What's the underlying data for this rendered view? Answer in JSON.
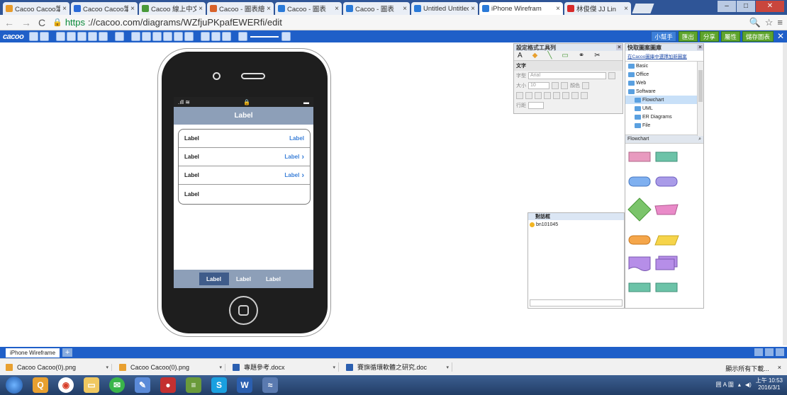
{
  "browser": {
    "tabs": [
      {
        "title": "Cacoo Cacoo筆記",
        "color": "#e89b2a"
      },
      {
        "title": "Cacoo Cacoo筆記",
        "color": "#2a6ad8"
      },
      {
        "title": "Cacoo 線上中文",
        "color": "#4a9a3a"
      },
      {
        "title": "Cacoo - 圖表繪製",
        "color": "#d8622a"
      },
      {
        "title": "Cacoo - 圖表",
        "color": "#2a7ad8"
      },
      {
        "title": "Cacoo - 圖表",
        "color": "#2a7ad8"
      },
      {
        "title": "Untitled Untitled",
        "color": "#2a7ad8"
      },
      {
        "title": "iPhone Wirefram",
        "color": "#2a7ad8",
        "active": true
      },
      {
        "title": "林俊傑 JJ Lin",
        "color": "#d82a2a"
      }
    ],
    "url_scheme": "https",
    "url_rest": "://cacoo.com/diagrams/WZfjuPKpafEWERfi/edit"
  },
  "app": {
    "logo": "cacoo",
    "right_buttons": [
      "小幫手",
      "匯出",
      "分享",
      "屬性",
      "儲存圖表"
    ]
  },
  "phone": {
    "navbar_title": "Label",
    "rows": [
      {
        "label": "Label",
        "value": "Label",
        "chevron": false
      },
      {
        "label": "Label",
        "value": "Label",
        "chevron": true
      },
      {
        "label": "Label",
        "value": "Label",
        "chevron": true
      },
      {
        "label": "Label",
        "value": "",
        "chevron": false
      }
    ],
    "tabs": [
      "Label",
      "Label",
      "Label"
    ]
  },
  "style_panel": {
    "title": "設定格式工具列",
    "section": "文字",
    "font_label": "字型",
    "font_value": "Arial",
    "size_label": "大小",
    "size_value": "10",
    "color_label": "顏色",
    "line_label": "行距"
  },
  "library": {
    "title": "快取圖案圖庫",
    "link": "在Cacoo圖庫中選擇加新圖案",
    "items": [
      {
        "name": "Basic",
        "level": 0,
        "selected": false
      },
      {
        "name": "Office",
        "level": 0,
        "selected": false
      },
      {
        "name": "Web",
        "level": 0,
        "selected": false
      },
      {
        "name": "Software",
        "level": 0,
        "selected": false
      },
      {
        "name": "Flowchart",
        "level": 1,
        "selected": true
      },
      {
        "name": "UML",
        "level": 1,
        "selected": false
      },
      {
        "name": "ER Diagrams",
        "level": 1,
        "selected": false
      },
      {
        "name": "File",
        "level": 1,
        "selected": false
      }
    ],
    "category": "Flowchart"
  },
  "chat": {
    "title": "對話框",
    "user": "bn101045"
  },
  "sheet": {
    "tab_label": "iPhone Wireframe",
    "add": "+"
  },
  "downloads": {
    "items": [
      {
        "name": "Cacoo Cacoo(0).png",
        "color": "#e8a030"
      },
      {
        "name": "Cacoo Cacoo(0).png",
        "color": "#e8a030"
      },
      {
        "name": "專題參考.docx",
        "color": "#2b5fb0"
      },
      {
        "name": "賽旗循環軟體之研究.doc",
        "color": "#2b5fb0"
      }
    ],
    "show_all": "顯示所有下載...",
    "close": "×"
  },
  "taskbar": {
    "time": "上午 10:53",
    "date": "2016/3/1"
  },
  "colors": {
    "accent": "#1f5fc8",
    "ios_blue": "#3a7fd8",
    "navbar": "#8d9fb8"
  }
}
